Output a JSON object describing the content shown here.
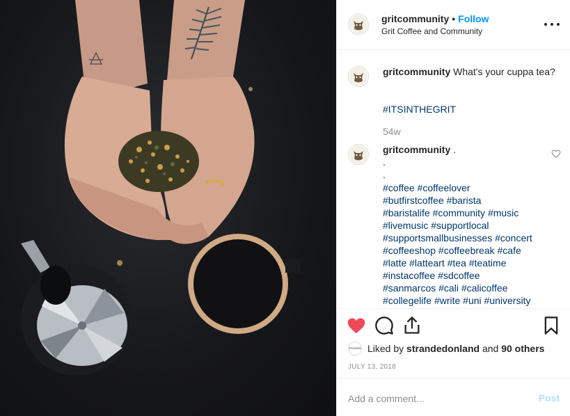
{
  "header": {
    "username": "gritcommunity",
    "separator": "•",
    "follow_label": "Follow",
    "subtitle": "Grit Coffee and Community",
    "avatar_icon": "cat-logo-icon",
    "more_icon": "more-options-icon"
  },
  "caption": {
    "username": "gritcommunity",
    "text": "What's your cuppa tea?",
    "hashtag": "#ITSINTHEGRIT",
    "time": "54w"
  },
  "comment": {
    "username": "gritcommunity",
    "text": ".",
    "dot1": ".",
    "dot2": ".",
    "lines": [
      "#coffee #coffeelover",
      "#butfirstcoffee #barista",
      "#baristalife #community #music",
      "#livemusic #supportlocal",
      "#supportsmallbusinesses #concert",
      "#coffeeshop #coffeebreak #cafe",
      "#latte #latteart #tea #teatime",
      "#instacoffee #sdcoffee",
      "#sanmarcos #cali #calicoffee",
      "#collegelife #write #uni #university"
    ],
    "like_icon": "heart-outline-icon"
  },
  "actions": {
    "like_icon": "heart-filled-icon",
    "comment_icon": "comment-bubble-icon",
    "share_icon": "share-icon",
    "save_icon": "bookmark-icon",
    "liked_prefix": "Liked by ",
    "liked_user": "strandedonland",
    "liked_and": " and ",
    "liked_count": "90 others",
    "liker_avatar_text": "Stranded",
    "date": "JULY 13, 2018"
  },
  "comment_form": {
    "placeholder": "Add a comment...",
    "post_label": "Post"
  },
  "colors": {
    "accent": "#0095f6",
    "hashtag": "#00376b",
    "like_red": "#ed4956",
    "muted": "#8e8e8e",
    "post_disabled": "#b2dffc"
  }
}
